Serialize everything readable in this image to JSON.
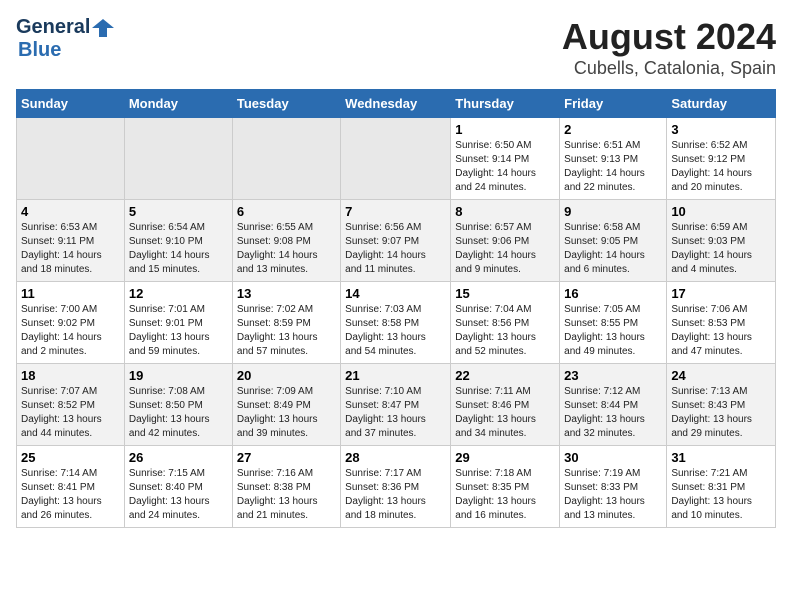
{
  "header": {
    "logo_general": "General",
    "logo_blue": "Blue",
    "title": "August 2024",
    "subtitle": "Cubells, Catalonia, Spain"
  },
  "days_of_week": [
    "Sunday",
    "Monday",
    "Tuesday",
    "Wednesday",
    "Thursday",
    "Friday",
    "Saturday"
  ],
  "weeks": [
    [
      {
        "day": "",
        "info": ""
      },
      {
        "day": "",
        "info": ""
      },
      {
        "day": "",
        "info": ""
      },
      {
        "day": "",
        "info": ""
      },
      {
        "day": "1",
        "info": "Sunrise: 6:50 AM\nSunset: 9:14 PM\nDaylight: 14 hours\nand 24 minutes."
      },
      {
        "day": "2",
        "info": "Sunrise: 6:51 AM\nSunset: 9:13 PM\nDaylight: 14 hours\nand 22 minutes."
      },
      {
        "day": "3",
        "info": "Sunrise: 6:52 AM\nSunset: 9:12 PM\nDaylight: 14 hours\nand 20 minutes."
      }
    ],
    [
      {
        "day": "4",
        "info": "Sunrise: 6:53 AM\nSunset: 9:11 PM\nDaylight: 14 hours\nand 18 minutes."
      },
      {
        "day": "5",
        "info": "Sunrise: 6:54 AM\nSunset: 9:10 PM\nDaylight: 14 hours\nand 15 minutes."
      },
      {
        "day": "6",
        "info": "Sunrise: 6:55 AM\nSunset: 9:08 PM\nDaylight: 14 hours\nand 13 minutes."
      },
      {
        "day": "7",
        "info": "Sunrise: 6:56 AM\nSunset: 9:07 PM\nDaylight: 14 hours\nand 11 minutes."
      },
      {
        "day": "8",
        "info": "Sunrise: 6:57 AM\nSunset: 9:06 PM\nDaylight: 14 hours\nand 9 minutes."
      },
      {
        "day": "9",
        "info": "Sunrise: 6:58 AM\nSunset: 9:05 PM\nDaylight: 14 hours\nand 6 minutes."
      },
      {
        "day": "10",
        "info": "Sunrise: 6:59 AM\nSunset: 9:03 PM\nDaylight: 14 hours\nand 4 minutes."
      }
    ],
    [
      {
        "day": "11",
        "info": "Sunrise: 7:00 AM\nSunset: 9:02 PM\nDaylight: 14 hours\nand 2 minutes."
      },
      {
        "day": "12",
        "info": "Sunrise: 7:01 AM\nSunset: 9:01 PM\nDaylight: 13 hours\nand 59 minutes."
      },
      {
        "day": "13",
        "info": "Sunrise: 7:02 AM\nSunset: 8:59 PM\nDaylight: 13 hours\nand 57 minutes."
      },
      {
        "day": "14",
        "info": "Sunrise: 7:03 AM\nSunset: 8:58 PM\nDaylight: 13 hours\nand 54 minutes."
      },
      {
        "day": "15",
        "info": "Sunrise: 7:04 AM\nSunset: 8:56 PM\nDaylight: 13 hours\nand 52 minutes."
      },
      {
        "day": "16",
        "info": "Sunrise: 7:05 AM\nSunset: 8:55 PM\nDaylight: 13 hours\nand 49 minutes."
      },
      {
        "day": "17",
        "info": "Sunrise: 7:06 AM\nSunset: 8:53 PM\nDaylight: 13 hours\nand 47 minutes."
      }
    ],
    [
      {
        "day": "18",
        "info": "Sunrise: 7:07 AM\nSunset: 8:52 PM\nDaylight: 13 hours\nand 44 minutes."
      },
      {
        "day": "19",
        "info": "Sunrise: 7:08 AM\nSunset: 8:50 PM\nDaylight: 13 hours\nand 42 minutes."
      },
      {
        "day": "20",
        "info": "Sunrise: 7:09 AM\nSunset: 8:49 PM\nDaylight: 13 hours\nand 39 minutes."
      },
      {
        "day": "21",
        "info": "Sunrise: 7:10 AM\nSunset: 8:47 PM\nDaylight: 13 hours\nand 37 minutes."
      },
      {
        "day": "22",
        "info": "Sunrise: 7:11 AM\nSunset: 8:46 PM\nDaylight: 13 hours\nand 34 minutes."
      },
      {
        "day": "23",
        "info": "Sunrise: 7:12 AM\nSunset: 8:44 PM\nDaylight: 13 hours\nand 32 minutes."
      },
      {
        "day": "24",
        "info": "Sunrise: 7:13 AM\nSunset: 8:43 PM\nDaylight: 13 hours\nand 29 minutes."
      }
    ],
    [
      {
        "day": "25",
        "info": "Sunrise: 7:14 AM\nSunset: 8:41 PM\nDaylight: 13 hours\nand 26 minutes."
      },
      {
        "day": "26",
        "info": "Sunrise: 7:15 AM\nSunset: 8:40 PM\nDaylight: 13 hours\nand 24 minutes."
      },
      {
        "day": "27",
        "info": "Sunrise: 7:16 AM\nSunset: 8:38 PM\nDaylight: 13 hours\nand 21 minutes."
      },
      {
        "day": "28",
        "info": "Sunrise: 7:17 AM\nSunset: 8:36 PM\nDaylight: 13 hours\nand 18 minutes."
      },
      {
        "day": "29",
        "info": "Sunrise: 7:18 AM\nSunset: 8:35 PM\nDaylight: 13 hours\nand 16 minutes."
      },
      {
        "day": "30",
        "info": "Sunrise: 7:19 AM\nSunset: 8:33 PM\nDaylight: 13 hours\nand 13 minutes."
      },
      {
        "day": "31",
        "info": "Sunrise: 7:21 AM\nSunset: 8:31 PM\nDaylight: 13 hours\nand 10 minutes."
      }
    ]
  ]
}
